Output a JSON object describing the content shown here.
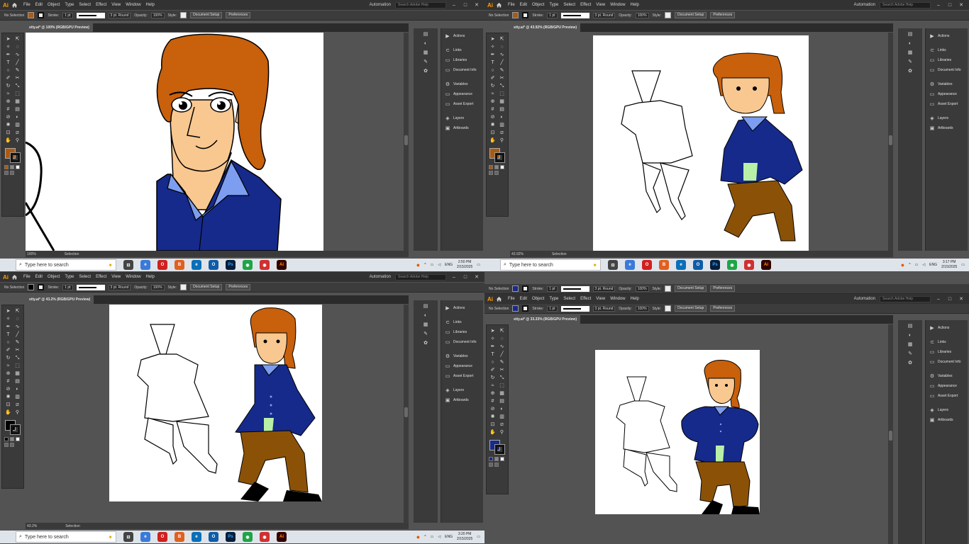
{
  "menus": [
    "File",
    "Edit",
    "Object",
    "Type",
    "Select",
    "Effect",
    "View",
    "Window",
    "Help"
  ],
  "workspace": "Automation",
  "search_placeholder": "Search Adobe Help",
  "control": {
    "selection": "No Selection",
    "stroke_label": "Stroke:",
    "stroke_weight": "1 pt",
    "profile": "Uniform",
    "brush": "3 pt. Round",
    "opacity_label": "Opacity:",
    "opacity_value": "100%",
    "style_label": "Style:",
    "doc_setup": "Document Setup",
    "preferences": "Preferences"
  },
  "panels": [
    "Actions",
    "Links",
    "Libraries",
    "Document Info",
    "Variables",
    "Appearance",
    "Asset Export",
    "Layers",
    "Artboards"
  ],
  "taskbar": {
    "search_text": "Type here to search",
    "lang": "ENG",
    "date": "2/15/2025"
  },
  "quadrants": [
    {
      "tab": "stty.ai* @ 100% (RGB/GPU Preview)",
      "zoom": "100%",
      "status": "Selection",
      "time": "2:50 PM",
      "fill": "#b05a10"
    },
    {
      "tab": "stty.ai* @ 43.92% (RGB/GPU Preview)",
      "zoom": "43.92%",
      "status": "Selection",
      "time": "3:17 PM",
      "fill": "#a85a14"
    },
    {
      "tab": "stty.ai* @ 43.2% (RGB/GPU Preview)",
      "zoom": "43.2%",
      "status": "Selection",
      "time": "3:20 PM",
      "fill": "#000000"
    },
    {
      "tab": "stty.ai* @ 33.33% (RGB/GPU Preview)",
      "zoom": "",
      "status": "",
      "time": "",
      "fill": "#1a2a8a"
    }
  ],
  "colors": {
    "hair": "#c8600c",
    "skin": "#f9c890",
    "jacket": "#152a8a",
    "collar": "#7d9ef0",
    "pants": "#8b5207",
    "shirt": "#b8f0a8",
    "shoes": "#000000",
    "ui_dark": "#535353"
  }
}
